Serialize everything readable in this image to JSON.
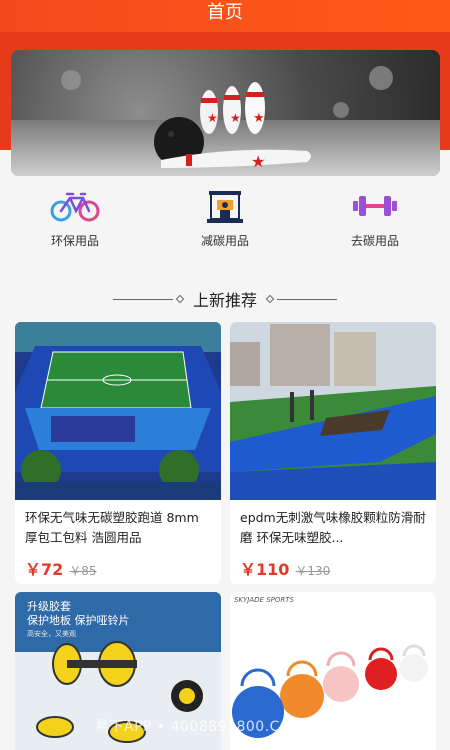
{
  "header": {
    "title": "首页"
  },
  "categories": [
    {
      "label": "环保用品",
      "icon": "bicycle-icon"
    },
    {
      "label": "减碳用品",
      "icon": "machine-icon"
    },
    {
      "label": "去碳用品",
      "icon": "dumbbell-icon"
    }
  ],
  "section": {
    "title": "上新推荐"
  },
  "products": [
    {
      "title": "环保无气味无碳塑胶跑道 8mm厚包工包料 浩圆用品",
      "price": "￥72",
      "old_price": "￥85"
    },
    {
      "title": "epdm无刺激气味橡胶颗粒防滑耐磨 环保无味塑胶...",
      "price": "￥110",
      "old_price": "￥130"
    },
    {
      "banner_line1": "升级胶套",
      "banner_line2": "保护地板  保护哑铃片",
      "banner_line3": "高安全，又美观"
    },
    {
      "brand": "SKYJADE SPORTS"
    }
  ],
  "watermark": "易下APP • 4008891800.COM",
  "colors": {
    "accent": "#e23a2a",
    "header": "#f24a1d"
  }
}
